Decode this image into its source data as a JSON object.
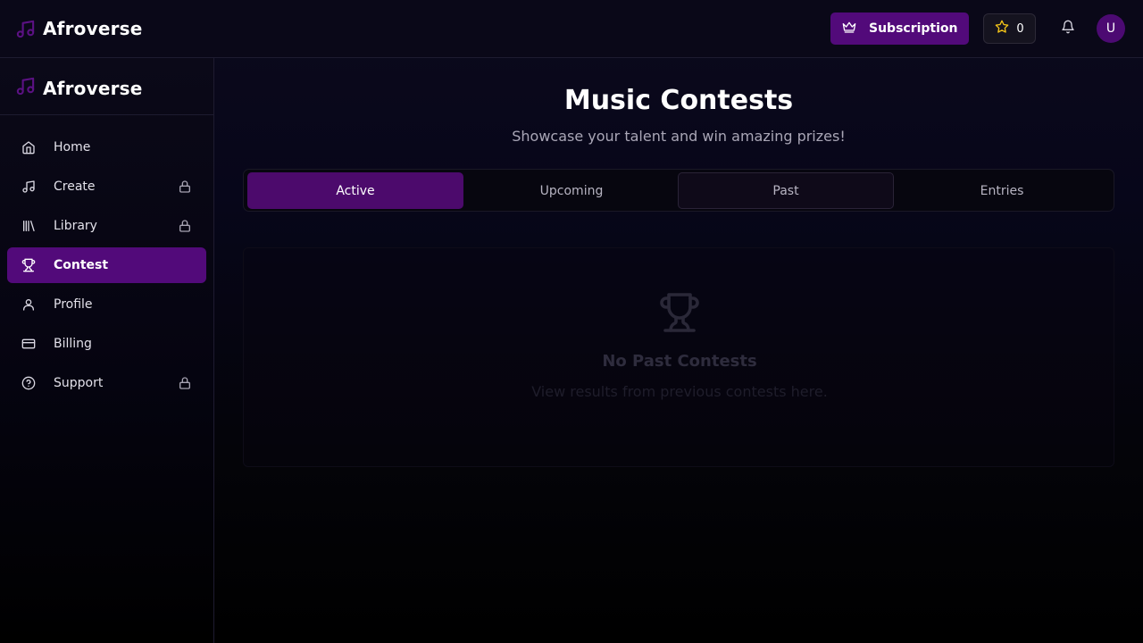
{
  "app": {
    "name": "Afroverse"
  },
  "header": {
    "subscription_label": "Subscription",
    "credits": "0",
    "avatar_initial": "U"
  },
  "sidebar": {
    "brand": "Afroverse",
    "items": [
      {
        "label": "Home",
        "icon": "home-icon",
        "locked": false,
        "active": false
      },
      {
        "label": "Create",
        "icon": "music-note-icon",
        "locked": true,
        "active": false
      },
      {
        "label": "Library",
        "icon": "library-icon",
        "locked": true,
        "active": false
      },
      {
        "label": "Contest",
        "icon": "trophy-icon",
        "locked": false,
        "active": true
      },
      {
        "label": "Profile",
        "icon": "user-icon",
        "locked": false,
        "active": false
      },
      {
        "label": "Billing",
        "icon": "credit-card-icon",
        "locked": false,
        "active": false
      },
      {
        "label": "Support",
        "icon": "help-circle-icon",
        "locked": true,
        "active": false
      }
    ]
  },
  "main": {
    "title": "Music Contests",
    "subtitle": "Showcase your talent and win amazing prizes!",
    "tabs": [
      {
        "label": "Active"
      },
      {
        "label": "Upcoming"
      },
      {
        "label": "Past"
      },
      {
        "label": "Entries"
      }
    ],
    "empty_state": {
      "title": "No Past Contests",
      "text": "View results from previous contests here."
    }
  },
  "colors": {
    "accent": "#520a7a",
    "star": "#f5c518"
  }
}
